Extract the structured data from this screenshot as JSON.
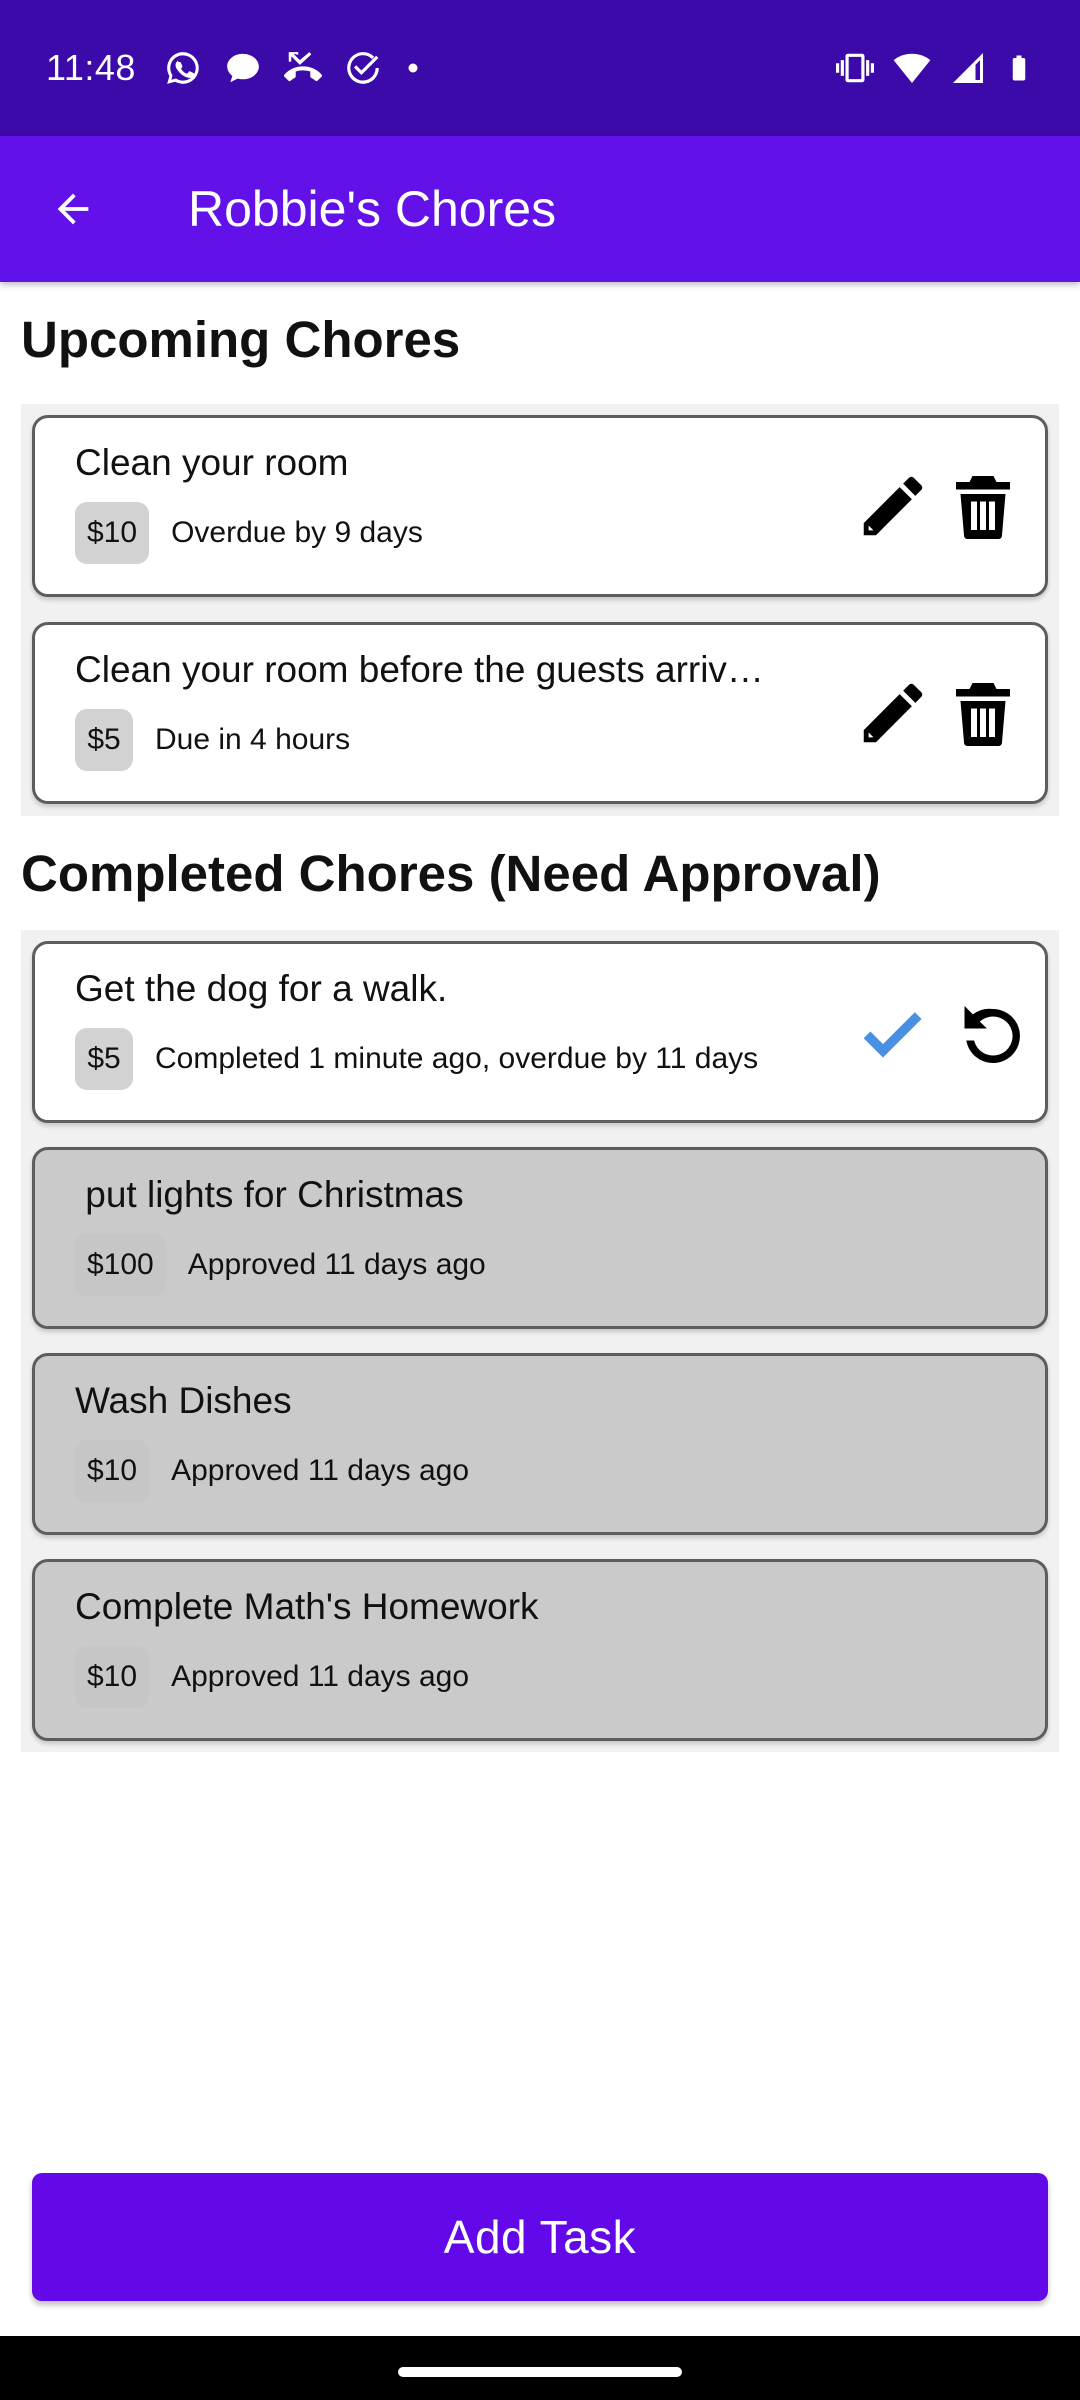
{
  "status_bar": {
    "time": "11:48",
    "left_icons": [
      "whatsapp-icon",
      "chat-bubble-icon",
      "missed-call-icon",
      "check-circle-icon",
      "dot-icon"
    ],
    "right_icons": [
      "vibrate-icon",
      "wifi-icon",
      "signal-icon",
      "battery-icon"
    ]
  },
  "app_bar": {
    "title": "Robbie's Chores",
    "back_icon": "arrow-left-icon"
  },
  "upcoming": {
    "heading": "Upcoming Chores",
    "items": [
      {
        "title": "Clean your room",
        "price": "$10",
        "status": "Overdue by 9 days"
      },
      {
        "title": "Clean your room before the guests arriv…",
        "price": "$5",
        "status": "Due in 4 hours"
      }
    ]
  },
  "completed": {
    "heading": "Completed Chores (Need Approval)",
    "pending": {
      "title": "Get the dog for a walk.",
      "price": "$5",
      "status": "Completed 1 minute ago, overdue by 11 days"
    },
    "approved": [
      {
        "title": " put lights for Christmas",
        "price": "$100",
        "status": "Approved 11 days ago"
      },
      {
        "title": "Wash Dishes",
        "price": "$10",
        "status": "Approved 11 days ago"
      },
      {
        "title": "Complete Math's Homework",
        "price": "$10",
        "status": "Approved 11 days ago"
      }
    ]
  },
  "add_task": {
    "label": "Add Task"
  },
  "colors": {
    "status_bar": "#3b0aa8",
    "app_bar": "#6211e8",
    "button": "#6308e8",
    "approve_check": "#4a90e2",
    "approved_card": "#cacaca"
  }
}
